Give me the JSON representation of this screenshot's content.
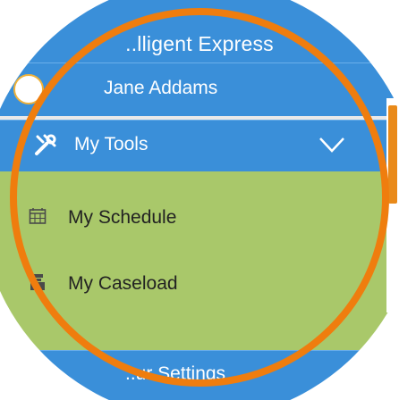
{
  "app": {
    "title": "..lligent Express"
  },
  "user": {
    "name": "Jane Addams"
  },
  "menu": {
    "tools_label": "My Tools",
    "schedule_label": "My Schedule",
    "caseload_label": "My Caseload",
    "settings_label": "..ur Settings"
  },
  "colors": {
    "header_blue": "#3a8fd9",
    "menu_green": "#a9c86a",
    "ring_orange": "#ef7d0e"
  },
  "icons": {
    "avatar": "person-avatar",
    "tools": "tools-icon",
    "expand": "chevron-down-icon",
    "schedule": "calendar-icon",
    "caseload": "caseload-icon"
  }
}
